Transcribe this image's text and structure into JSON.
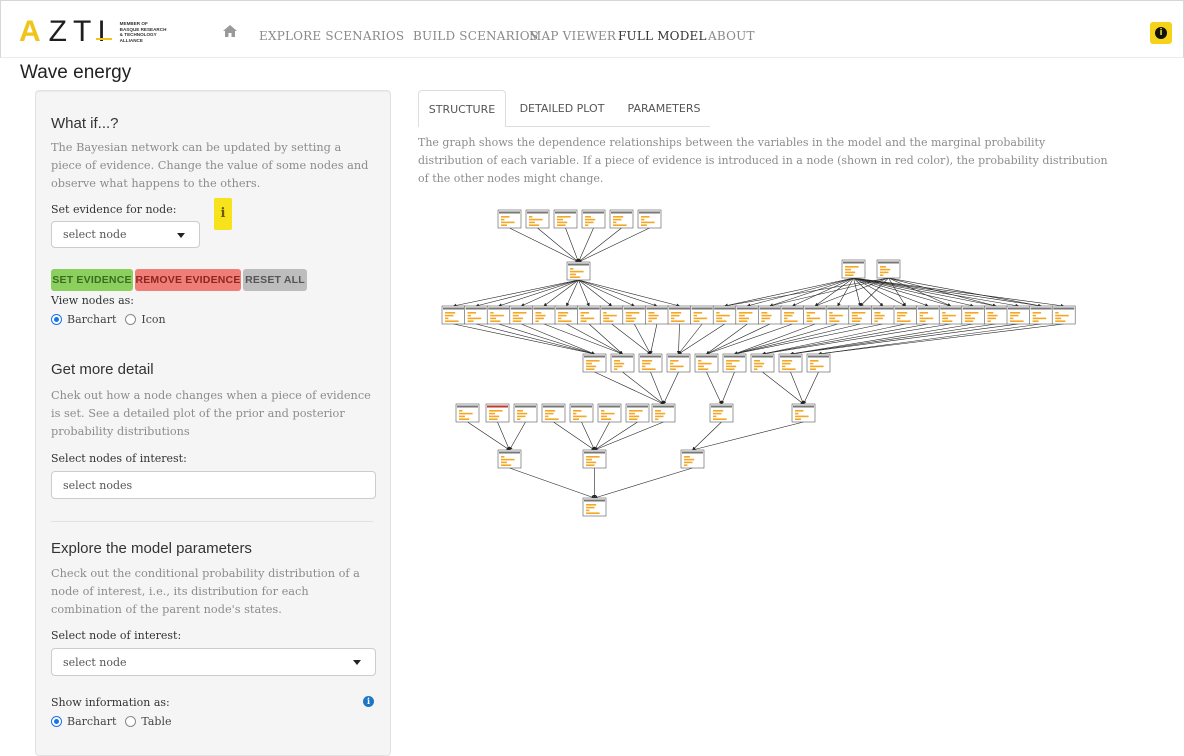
{
  "brand": {
    "letters": "AZTI",
    "tagline": [
      "MEMBER OF",
      "BASQUE RESEARCH",
      "& TECHNOLOGY ALLIANCE"
    ]
  },
  "nav": {
    "home_icon": "home-icon",
    "items": [
      "EXPLORE SCENARIOS",
      "BUILD SCENARIOS",
      "MAP VIEWER",
      "FULL MODEL",
      "ABOUT"
    ],
    "active": "FULL MODEL",
    "info_glyph": "i"
  },
  "page_title": "Wave energy",
  "sidebar": {
    "whatif": {
      "title": "What if...?",
      "text": "The Bayesian network can be updated by setting a piece of evidence. Change the value of some nodes and observe what happens to the others.",
      "evidence_label": "Set evidence for node:",
      "evidence_placeholder": "select node",
      "hint_glyph": "i",
      "btn_set": "SET EVIDENCE",
      "btn_remove": "REMOVE EVIDENCE",
      "btn_reset": "RESET ALL",
      "view_label": "View nodes as:",
      "view_options": [
        "Barchart",
        "Icon"
      ],
      "view_selected": "Barchart"
    },
    "detail": {
      "title": "Get more detail",
      "text": "Chek out how a node changes when a piece of evidence is set. See a detailed plot of the prior and posterior probability distributions",
      "nodes_label": "Select nodes of interest:",
      "nodes_placeholder": "select nodes"
    },
    "params": {
      "title": "Explore the model parameters",
      "text": "Check out the conditional probability distribution of a node of interest, i.e., its distribution for each combination of the parent node's states.",
      "node_label": "Select node of interest:",
      "node_placeholder": "select node",
      "show_label": "Show information as:",
      "show_options": [
        "Barchart",
        "Table"
      ],
      "show_selected": "Barchart",
      "info_glyph": "i"
    }
  },
  "tabs": [
    "STRUCTURE",
    "DETAILED PLOT",
    "PARAMETERS"
  ],
  "active_tab": "STRUCTURE",
  "description": "The graph shows the dependence relationships between the variables in the model and the marginal probability distribution of each variable. If a piece of evidence is introduced in a node (shown in red color), the probability distribution of the other nodes might change.",
  "colors": {
    "accent_yellow": "#f6d21b",
    "set_green": "#8bd05f",
    "remove_red": "#ef7d78",
    "reset_grey": "#bdbdbd",
    "node_bar": "#f5a623",
    "evidence_red": "#c0392b"
  }
}
